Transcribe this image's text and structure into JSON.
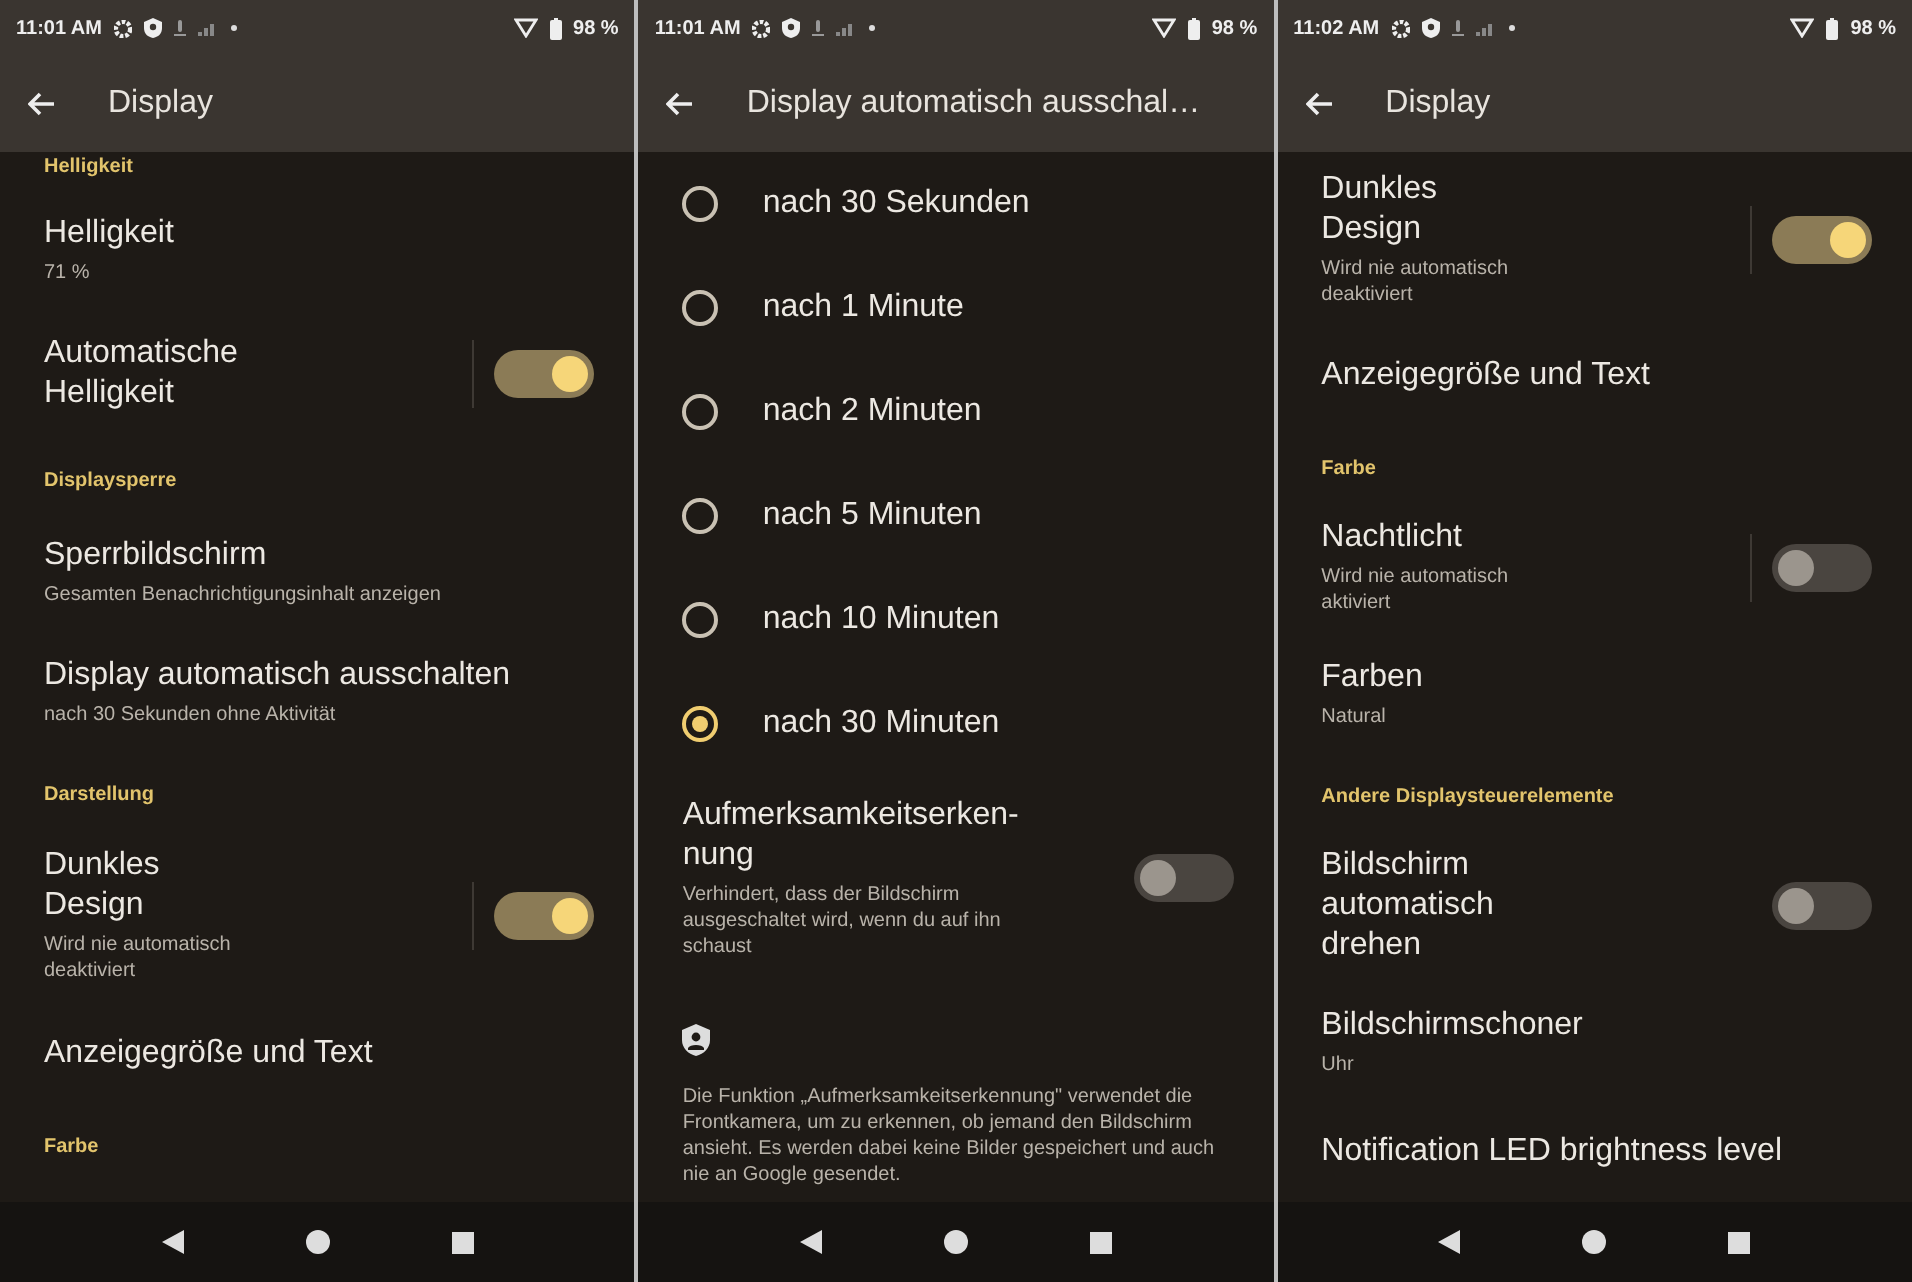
{
  "screens": [
    {
      "status": {
        "time": "11:01 AM",
        "battery": "98 %"
      },
      "app_bar": {
        "title": "Display"
      },
      "items": [
        {
          "kind": "header",
          "title": "Helligkeit"
        },
        {
          "kind": "item",
          "title": "Helligkeit",
          "subtitle": "71 %"
        },
        {
          "kind": "toggle",
          "title": "Automatische Helligkeit",
          "on": true,
          "split": true
        },
        {
          "kind": "header",
          "title": "Displaysperre"
        },
        {
          "kind": "item",
          "title": "Sperrbildschirm",
          "subtitle": "Gesamten Benachrichtigungsinhalt anzeigen"
        },
        {
          "kind": "item",
          "title": "Display automatisch ausschalten",
          "subtitle": "nach 30 Sekunden ohne Aktivität"
        },
        {
          "kind": "header",
          "title": "Darstellung"
        },
        {
          "kind": "toggle",
          "title": "Dunkles Design",
          "subtitle": "Wird nie automatisch deaktiviert",
          "on": true,
          "split": true
        },
        {
          "kind": "item",
          "title": "Anzeigegröße und Text"
        },
        {
          "kind": "header",
          "title": "Farbe"
        }
      ]
    },
    {
      "status": {
        "time": "11:01 AM",
        "battery": "98 %"
      },
      "app_bar": {
        "title": "Display automatisch ausschal…"
      },
      "items": [
        {
          "kind": "radio",
          "title": "nach 30 Sekunden",
          "selected": false
        },
        {
          "kind": "radio",
          "title": "nach 1 Minute",
          "selected": false
        },
        {
          "kind": "radio",
          "title": "nach 2 Minuten",
          "selected": false
        },
        {
          "kind": "radio",
          "title": "nach 5 Minuten",
          "selected": false
        },
        {
          "kind": "radio",
          "title": "nach 10 Minuten",
          "selected": false
        },
        {
          "kind": "radio",
          "title": "nach 30 Minuten",
          "selected": true
        },
        {
          "kind": "toggle",
          "title": "Aufmerksamkeitserken-nung",
          "subtitle": "Verhindert, dass der Bildschirm ausgeschaltet wird, wenn du auf ihn schaust",
          "on": false,
          "split": false
        },
        {
          "kind": "icon"
        },
        {
          "kind": "paragraph",
          "title": "Die Funktion „Aufmerksamkeitserkennung\" verwendet die Frontkamera, um zu erkennen, ob jemand den Bildschirm ansieht. Es werden dabei keine Bilder gespeichert und auch nie an Google gesendet."
        }
      ]
    },
    {
      "status": {
        "time": "11:02 AM",
        "battery": "98 %"
      },
      "app_bar": {
        "title": "Display"
      },
      "items": [
        {
          "kind": "toggle",
          "title": "Dunkles Design",
          "subtitle": "Wird nie automatisch deaktiviert",
          "on": true,
          "split": true
        },
        {
          "kind": "item",
          "title": "Anzeigegröße und Text"
        },
        {
          "kind": "header",
          "title": "Farbe"
        },
        {
          "kind": "toggle",
          "title": "Nachtlicht",
          "subtitle": "Wird nie automatisch aktiviert",
          "on": false,
          "split": true
        },
        {
          "kind": "item",
          "title": "Farben",
          "subtitle": "Natural"
        },
        {
          "kind": "header",
          "title": "Andere Displaysteuerelemente"
        },
        {
          "kind": "toggle",
          "title": "Bildschirm automatisch drehen",
          "on": false,
          "split": false
        },
        {
          "kind": "item",
          "title": "Bildschirmschoner",
          "subtitle": "Uhr"
        },
        {
          "kind": "item",
          "title": "Notification LED brightness level"
        }
      ]
    }
  ]
}
